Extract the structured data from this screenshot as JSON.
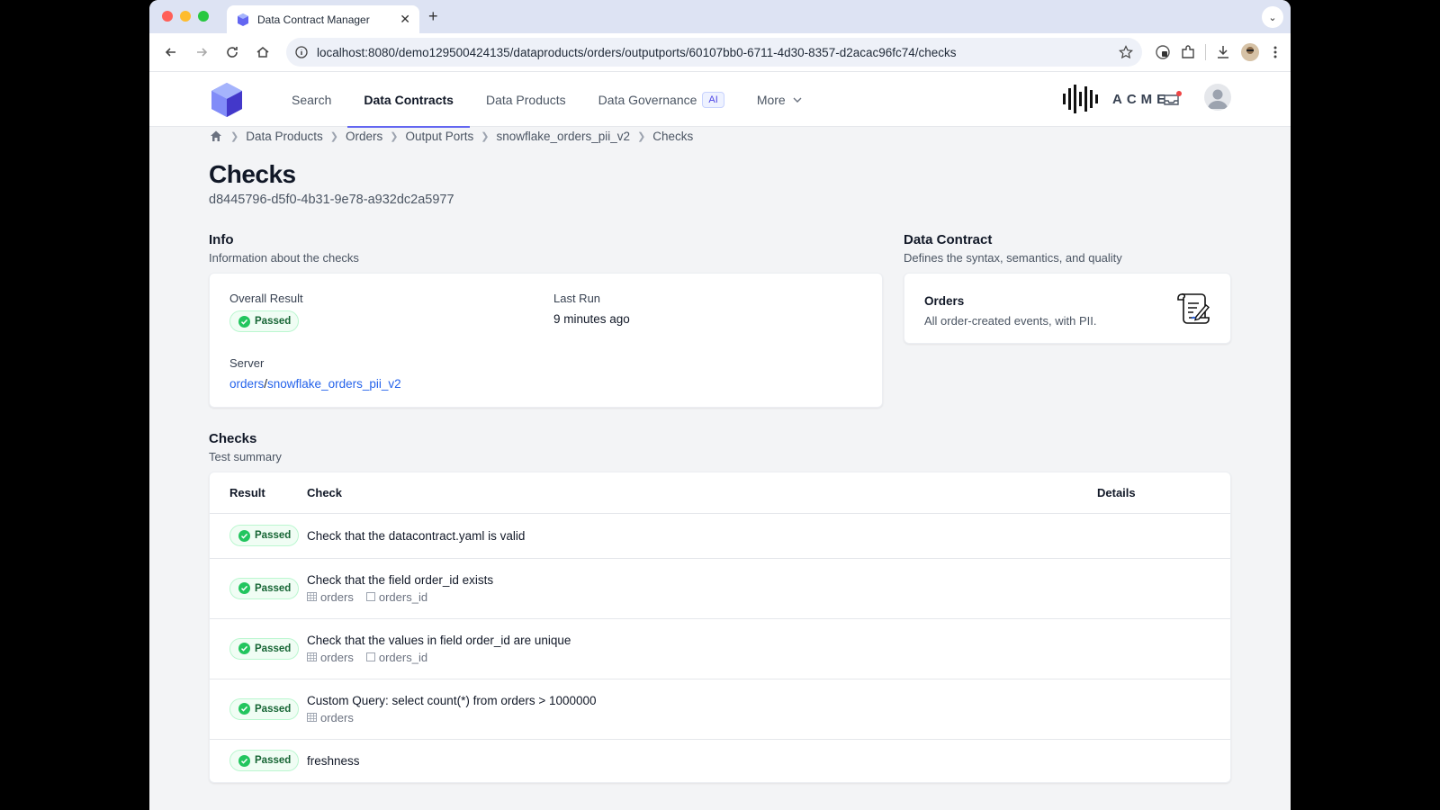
{
  "browser": {
    "tab_title": "Data Contract Manager",
    "url": "localhost:8080/demo129500424135/dataproducts/orders/outputports/60107bb0-6711-4d30-8357-d2acac96fc74/checks"
  },
  "nav": {
    "items": [
      {
        "label": "Search",
        "active": false
      },
      {
        "label": "Data Contracts",
        "active": true
      },
      {
        "label": "Data Products",
        "active": false
      },
      {
        "label": "Data Governance",
        "active": false
      },
      {
        "label": "More",
        "active": false
      }
    ],
    "ai_badge": "AI",
    "brand": "ACME",
    "accent_color": "#6366f1"
  },
  "breadcrumb": [
    "Data Products",
    "Orders",
    "Output Ports",
    "snowflake_orders_pii_v2",
    "Checks"
  ],
  "page": {
    "title": "Checks",
    "id": "d8445796-d5f0-4b31-9e78-a932dc2a5977"
  },
  "info": {
    "title": "Info",
    "subtitle": "Information about the checks",
    "overall_label": "Overall Result",
    "overall_value": "Passed",
    "last_run_label": "Last Run",
    "last_run_value": "9 minutes ago",
    "server_label": "Server",
    "server_part1": "orders",
    "server_sep": "/",
    "server_part2": "snowflake_orders_pii_v2"
  },
  "contract": {
    "title": "Data Contract",
    "subtitle": "Defines the syntax, semantics, and quality",
    "name": "Orders",
    "description": "All order-created events, with PII."
  },
  "checks": {
    "title": "Checks",
    "subtitle": "Test summary",
    "headers": {
      "result": "Result",
      "check": "Check",
      "details": "Details"
    },
    "rows": [
      {
        "result": "Passed",
        "check": "Check that the datacontract.yaml is valid",
        "model": "",
        "field": ""
      },
      {
        "result": "Passed",
        "check": "Check that the field order_id exists",
        "model": "orders",
        "field": "orders_id"
      },
      {
        "result": "Passed",
        "check": "Check that the values in field order_id are unique",
        "model": "orders",
        "field": "orders_id"
      },
      {
        "result": "Passed",
        "check": "Custom Query: select count(*) from orders > 1000000",
        "model": "orders",
        "field": ""
      },
      {
        "result": "Passed",
        "check": "freshness",
        "model": "",
        "field": ""
      }
    ]
  }
}
